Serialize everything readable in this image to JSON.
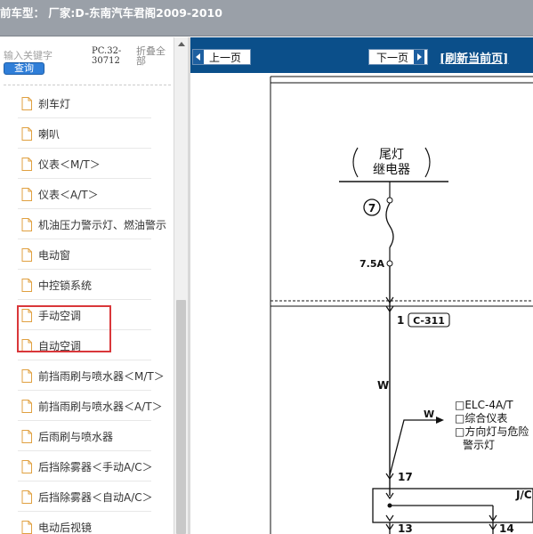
{
  "title_bar": {
    "text": "前车型： 厂家:D-东南汽车君阁2009-2010"
  },
  "search": {
    "placeholder": "输入关键字",
    "pc_code": "PC.32-30712",
    "collapse_all": "折叠全部",
    "query_button": "查询"
  },
  "tree": {
    "items": [
      {
        "label": "刹车灯"
      },
      {
        "label": "喇叭"
      },
      {
        "label": "仪表＜M/T＞"
      },
      {
        "label": "仪表＜A/T＞"
      },
      {
        "label": "机油压力警示灯、燃油警示"
      },
      {
        "label": "电动窗"
      },
      {
        "label": "中控锁系统"
      },
      {
        "label": "手动空调"
      },
      {
        "label": "自动空调"
      },
      {
        "label": "前挡雨刷与喷水器＜M/T＞"
      },
      {
        "label": "前挡雨刷与喷水器＜A/T＞"
      },
      {
        "label": "后雨刷与喷水器"
      },
      {
        "label": "后挡除雾器＜手动A/C＞"
      },
      {
        "label": "后挡除雾器＜自动A/C＞"
      },
      {
        "label": "电动后视镜"
      }
    ]
  },
  "nav": {
    "prev_label": "上一页",
    "next_label": "下一页",
    "refresh_label": "[刷新当前页]"
  },
  "diagram": {
    "relay_line1": "尾灯",
    "relay_line2": "继电器",
    "fuse_number": "7",
    "fuse_rating": "7.5A",
    "pin_1": "1",
    "connector_1": "C-311",
    "wire_color_main": "W",
    "wire_color_branch": "W",
    "dest_1": "□ELC-4A/T",
    "dest_2": "□综合仪表",
    "dest_3": "□方向灯与危险",
    "dest_4": "警示灯",
    "pin_17": "17",
    "jc_label": "J/C",
    "pin_13": "13",
    "pin_14": "14"
  },
  "colors": {
    "title_bar_bg": "#9aa0a8",
    "nav_bar_bg": "#0b4f8a",
    "query_button_bg": "#2f7ed8",
    "highlight_border": "#d9373a"
  }
}
